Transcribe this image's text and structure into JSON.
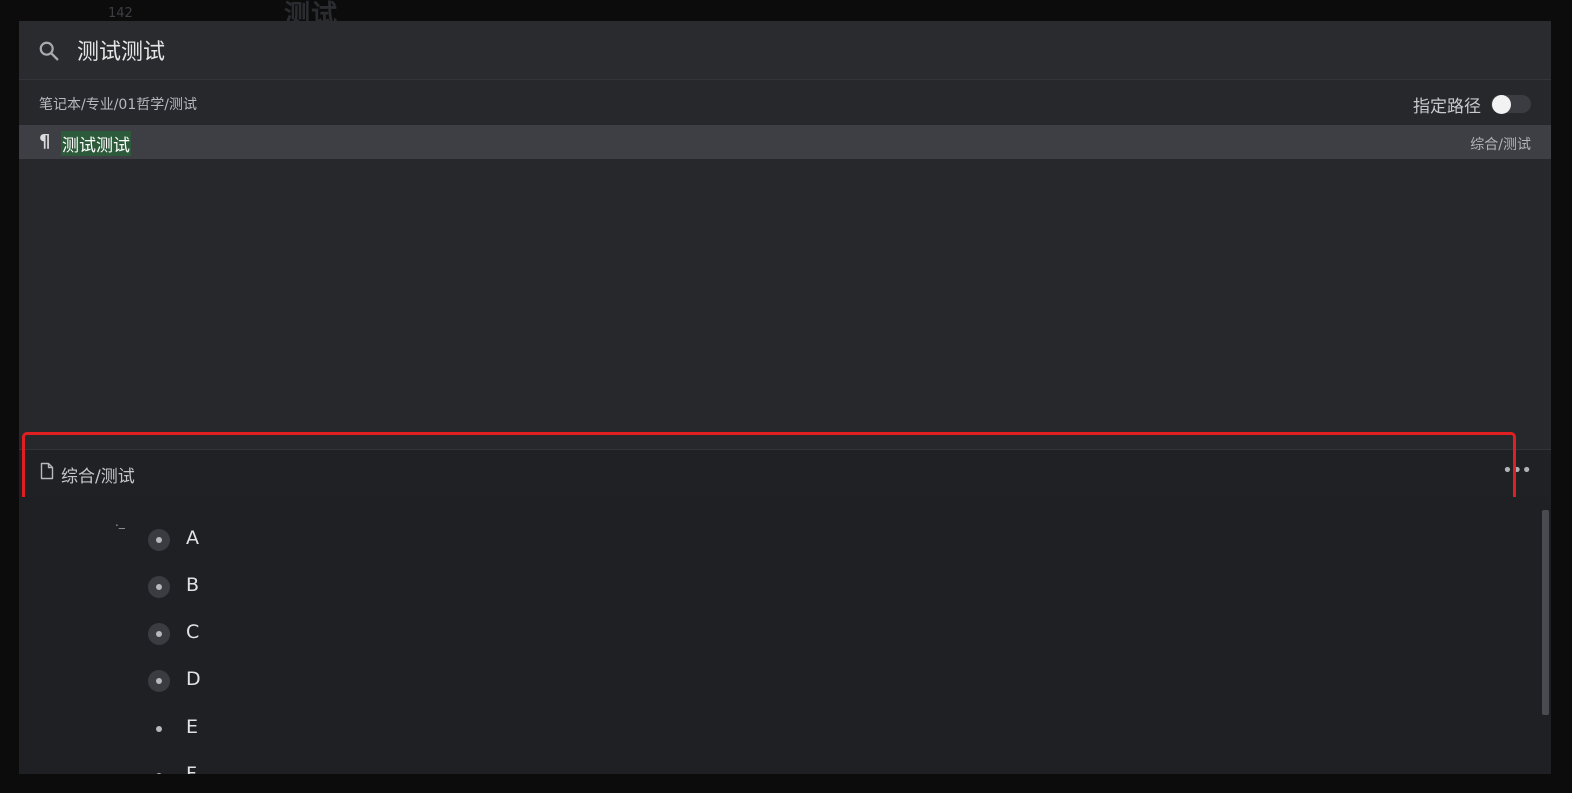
{
  "background": {
    "line_number": "142",
    "heading": "测试"
  },
  "search": {
    "value": "测试测试",
    "icon": "search-icon"
  },
  "path_row": {
    "path": "笔记本/专业/01哲学/测试",
    "toggle_label": "指定路径",
    "toggle_on": false
  },
  "results": [
    {
      "icon": "pilcrow-icon",
      "title": "测试测试",
      "path": "综合/测试"
    }
  ],
  "preview": {
    "icon": "file-icon",
    "title": "综合/测试",
    "more_icon": "more-icon",
    "items": [
      {
        "text": "A",
        "collapsed": true
      },
      {
        "text": "B",
        "collapsed": true
      },
      {
        "text": "C",
        "collapsed": true
      },
      {
        "text": "D",
        "collapsed": true
      },
      {
        "text": "E",
        "collapsed": false
      },
      {
        "text": "F",
        "collapsed": false
      }
    ]
  },
  "colors": {
    "highlight_border": "#e02020",
    "match_highlight": "#2d5a3a",
    "dialog_bg": "#27282c"
  }
}
